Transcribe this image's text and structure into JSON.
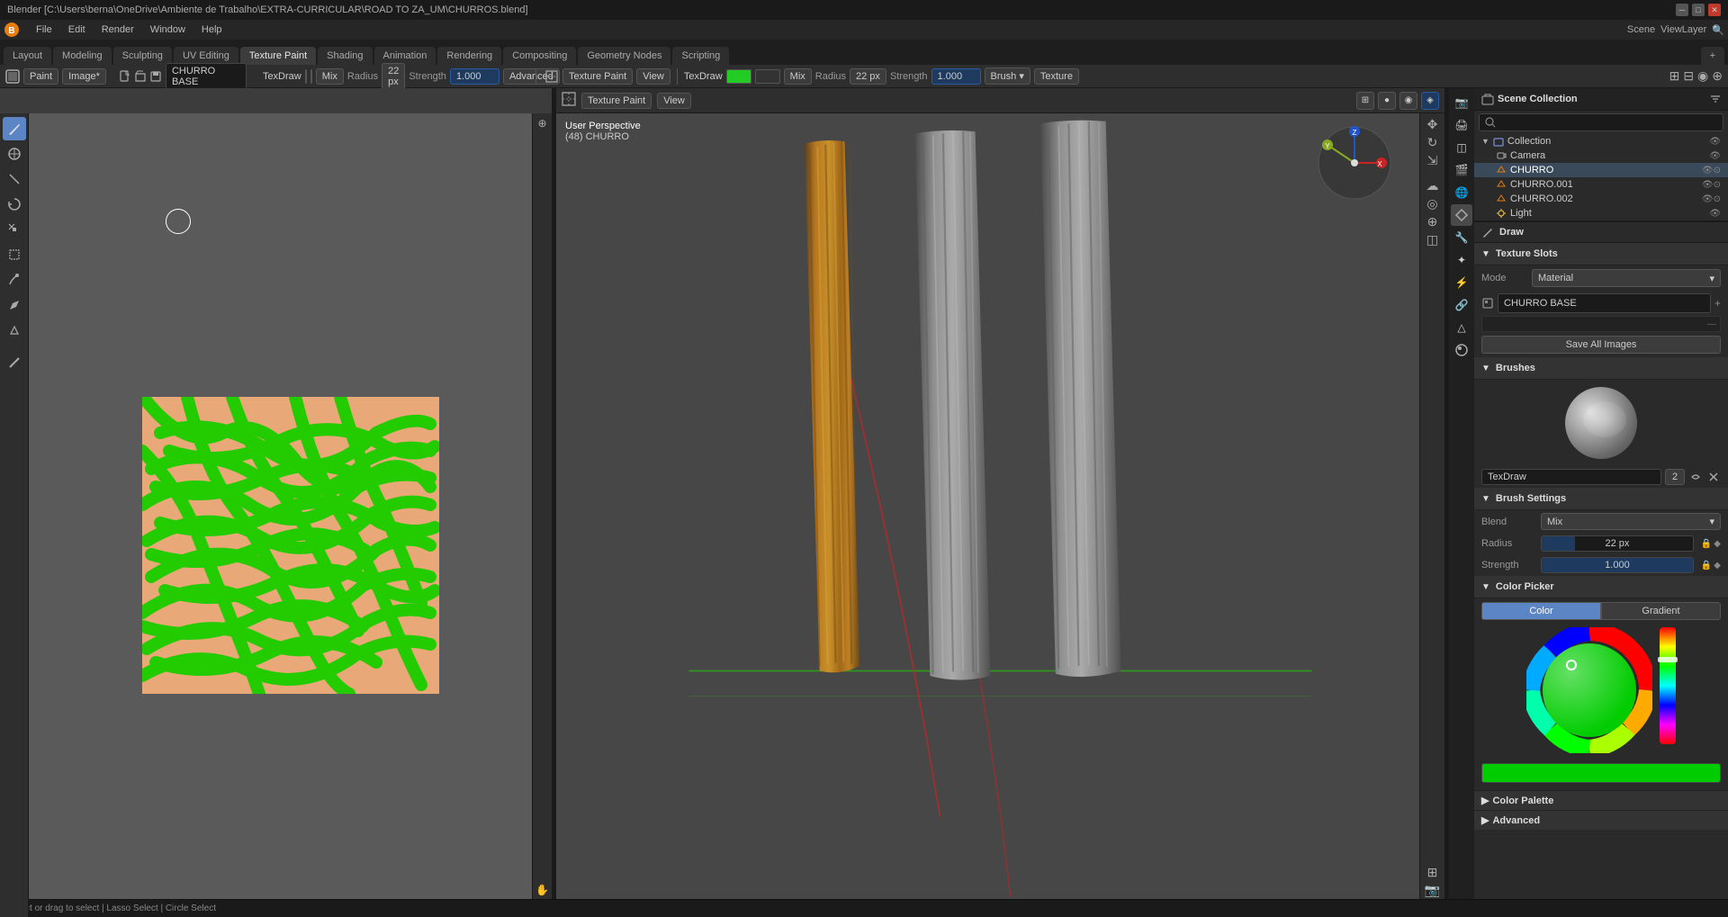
{
  "window": {
    "title": "Blender [C:\\Users\\berna\\OneDrive\\Ambiente de Trabalho\\EXTRA-CURRICULAR\\ROAD TO ZA_UM\\CHURROS.blend]",
    "minimize": "─",
    "maximize": "□",
    "close": "✕"
  },
  "menubar": {
    "items": [
      "Blender",
      "File",
      "Edit",
      "Render",
      "Window",
      "Help"
    ]
  },
  "workspace_tabs": {
    "items": [
      "Layout",
      "Modeling",
      "Sculpting",
      "UV Editing",
      "Texture Paint",
      "Shading",
      "Animation",
      "Rendering",
      "Compositing",
      "Geometry Nodes",
      "Scripting"
    ],
    "active": "Texture Paint"
  },
  "left_toolbar": {
    "mode": "Paint",
    "brush": "TexDraw",
    "color1": "#22cc22",
    "color2": "#333333",
    "blend": "Mix",
    "radius": "22 px",
    "strength": "1.000",
    "advanced": "Advanced"
  },
  "right_toolbar": {
    "mode": "Texture Paint",
    "brush": "TexDraw",
    "color1": "#22cc22",
    "color2": "#333333",
    "blend": "Mix",
    "radius": "22 px",
    "strength": "1.000",
    "view": "View"
  },
  "viewport": {
    "perspective": "User Perspective",
    "object_id": "(48) CHURRO"
  },
  "outliner": {
    "title": "Scene Collection",
    "search_placeholder": "",
    "items": [
      {
        "name": "Collection",
        "type": "collection",
        "indent": 0
      },
      {
        "name": "Camera",
        "type": "camera",
        "indent": 1
      },
      {
        "name": "CHURRO",
        "type": "mesh",
        "indent": 1,
        "active": true
      },
      {
        "name": "CHURRO.001",
        "type": "mesh",
        "indent": 1
      },
      {
        "name": "CHURRO.002",
        "type": "mesh",
        "indent": 1
      },
      {
        "name": "Light",
        "type": "light",
        "indent": 1
      }
    ]
  },
  "props": {
    "active_tool": "Draw",
    "texture_slots": {
      "title": "Texture Slots",
      "mode_label": "Mode",
      "mode_value": "Material",
      "slot_name": "CHURRO BASE",
      "save_all": "Save All Images"
    },
    "brushes": {
      "title": "Brushes",
      "brush_name": "TexDraw",
      "brush_count": "2"
    },
    "brush_settings": {
      "title": "Brush Settings",
      "blend_label": "Blend",
      "blend_value": "Mix",
      "radius_label": "Radius",
      "radius_value": "22 px",
      "strength_label": "Strength",
      "strength_value": "1.000"
    },
    "color_picker": {
      "title": "Color Picker",
      "tab_color": "Color",
      "tab_gradient": "Gradient",
      "active_tab": "Color",
      "current_color": "#00cc00"
    },
    "color_palette": {
      "title": "Color Palette",
      "arrow": "▶"
    },
    "advanced": {
      "title": "Advanced",
      "arrow": "▶"
    }
  },
  "tools": {
    "left": [
      {
        "id": "select",
        "icon": "⊹",
        "active": true
      },
      {
        "id": "cursor",
        "icon": "⊕"
      },
      {
        "id": "move",
        "icon": "✥"
      },
      {
        "id": "rotate",
        "icon": "↻"
      },
      {
        "id": "scale",
        "icon": "⇲"
      },
      {
        "id": "transform",
        "icon": "⊞"
      },
      {
        "id": "paint",
        "icon": "✎"
      },
      {
        "id": "erase",
        "icon": "◻"
      },
      {
        "id": "fill",
        "icon": "▤"
      },
      {
        "id": "mask",
        "icon": "◈"
      }
    ]
  },
  "statusbar": {
    "text": "Select or drag to select   |   Lasso Select   |   Circle Select"
  }
}
